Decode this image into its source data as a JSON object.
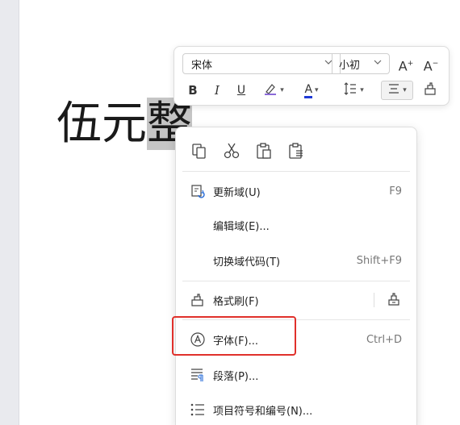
{
  "document": {
    "text_before": "伍元",
    "text_selected": "整"
  },
  "mini_toolbar": {
    "font_name": "宋体",
    "font_size": "小初",
    "grow_label": "A",
    "grow_sup": "+",
    "shrink_label": "A",
    "shrink_sup": "−",
    "bold_label": "B",
    "italic_label": "I",
    "underline_label": "U",
    "font_color_label": "A",
    "font_color": "#1e3ad6"
  },
  "context_menu": {
    "clipboard_icons": [
      "copy-icon",
      "cut-icon",
      "paste-icon",
      "paste-special-icon"
    ],
    "items": [
      {
        "label": "更新域(U)",
        "shortcut": "F9",
        "icon": "refresh-field-icon"
      },
      {
        "label": "编辑域(E)...",
        "shortcut": "",
        "icon": ""
      },
      {
        "label": "切换域代码(T)",
        "shortcut": "Shift+F9",
        "icon": ""
      },
      {
        "label": "格式刷(F)",
        "shortcut": "",
        "icon": "format-painter-icon"
      },
      {
        "label": "字体(F)...",
        "shortcut": "Ctrl+D",
        "icon": "font-icon"
      },
      {
        "label": "段落(P)...",
        "shortcut": "",
        "icon": "paragraph-icon"
      },
      {
        "label": "项目符号和编号(N)...",
        "shortcut": "",
        "icon": "bullets-numbering-icon"
      }
    ]
  },
  "highlight_color": "#e0302b"
}
